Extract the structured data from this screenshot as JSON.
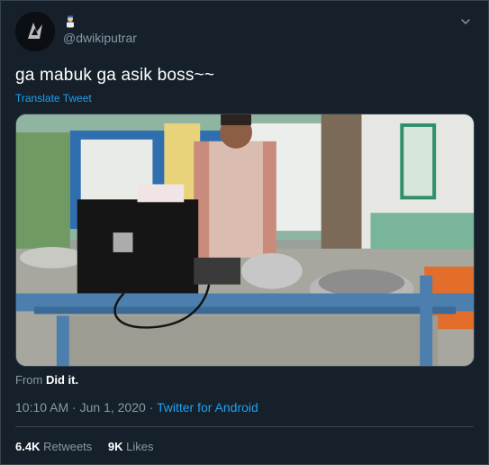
{
  "tweet": {
    "handle": "@dwikiputrar",
    "text": "ga mabuk ga asik boss~~",
    "translate_label": "Translate Tweet",
    "source_prefix": "From",
    "source_name": "Did it.",
    "time": "10:10 AM",
    "date": "Jun 1, 2020",
    "separator": "·",
    "client": "Twitter for Android",
    "stats": {
      "retweets_count": "6.4K",
      "retweets_label": "Retweets",
      "likes_count": "9K",
      "likes_label": "Likes"
    }
  },
  "icons": {
    "avatar": "avatar-image",
    "name_emoji": "person-emoji-icon",
    "menu": "chevron-down-icon"
  },
  "colors": {
    "background": "#15202b",
    "text_primary": "#ffffff",
    "text_secondary": "#8899a6",
    "accent": "#1da1f2",
    "border": "#38444d"
  }
}
